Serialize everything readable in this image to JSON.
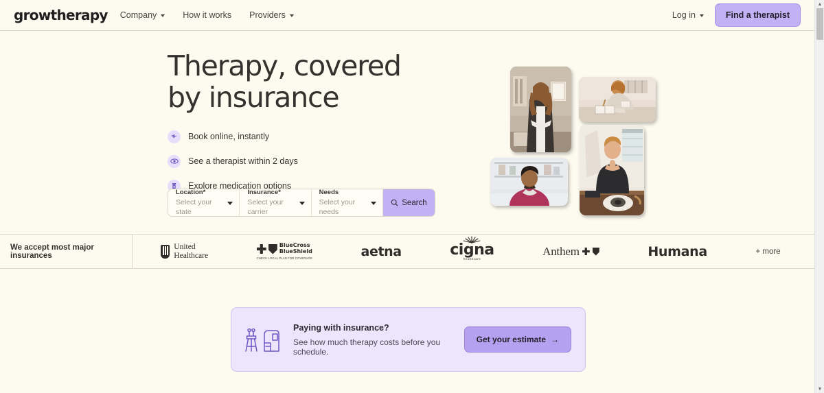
{
  "brand": {
    "logo_text": "growtherapy",
    "accent": "#c3b1f5",
    "background": "#fdfaef"
  },
  "header": {
    "nav": [
      {
        "label": "Company",
        "has_caret": true
      },
      {
        "label": "How it works",
        "has_caret": false
      },
      {
        "label": "Providers",
        "has_caret": true
      }
    ],
    "login_label": "Log in",
    "cta_label": "Find a therapist"
  },
  "hero": {
    "headline_line1": "Therapy, covered",
    "headline_line2": "by insurance",
    "bullets": [
      {
        "icon": "calendar-booking-icon",
        "label": "Book online, instantly"
      },
      {
        "icon": "eye-icon",
        "label": "See a therapist within 2 days"
      },
      {
        "icon": "pill-bottle-icon",
        "label": "Explore medication options"
      }
    ]
  },
  "search": {
    "fields": [
      {
        "label": "Location*",
        "value": "Select your state"
      },
      {
        "label": "Insurance*",
        "value": "Select your carrier"
      },
      {
        "label": "Needs",
        "value": "Select your needs"
      }
    ],
    "button_label": "Search"
  },
  "collage": {
    "photos": [
      {
        "alt": "Smiling woman in blazer standing in an office"
      },
      {
        "alt": "Person writing in a notebook at a desk"
      },
      {
        "alt": "Man at a desk with laptop resting chin on hand"
      },
      {
        "alt": "Smiling man in magenta shirt on a video call"
      }
    ]
  },
  "insurance_band": {
    "label": "We accept most major insurances",
    "logos": [
      {
        "name": "United Healthcare",
        "line1": "United",
        "line2": "Healthcare"
      },
      {
        "name": "BlueCross BlueShield",
        "line1": "BlueCross",
        "line2": "BlueShield",
        "sub": "CHECK LOCAL PLAN FOR COVERAGE"
      },
      {
        "name": "aetna",
        "text": "aetna"
      },
      {
        "name": "Cigna",
        "text": "cigna",
        "sub": "healthcare"
      },
      {
        "name": "Anthem",
        "text": "Anthem"
      },
      {
        "name": "Humana",
        "text": "Humana"
      }
    ],
    "more_label": "+ more"
  },
  "estimate_card": {
    "icon": "easel-and-chair-icon",
    "title": "Paying with insurance?",
    "subtitle": "See how much therapy costs before you schedule.",
    "button_label": "Get your estimate",
    "button_arrow": "→"
  },
  "scrollbar": {
    "up_arrow": "▲",
    "down_arrow": "▼"
  }
}
